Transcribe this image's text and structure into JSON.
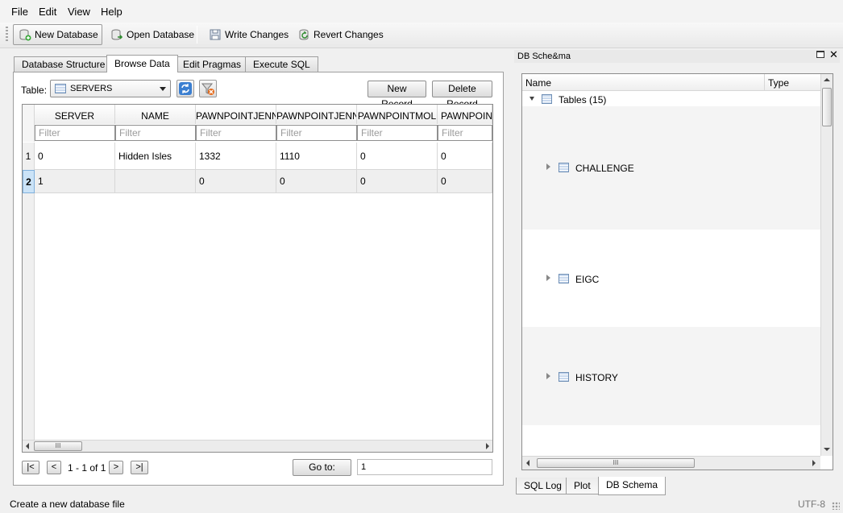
{
  "menu": [
    "File",
    "Edit",
    "View",
    "Help"
  ],
  "toolbar": {
    "new_database": "New Database",
    "open_database": "Open Database",
    "write_changes": "Write Changes",
    "revert_changes": "Revert Changes"
  },
  "tabs": [
    "Database Structure",
    "Browse Data",
    "Edit Pragmas",
    "Execute SQL"
  ],
  "browse": {
    "table_label": "Table:",
    "table_value": "SERVERS",
    "new_record": "New Record",
    "delete_record": "Delete Record",
    "columns": [
      "SERVER",
      "NAME",
      "PAWNPOINTJENN",
      "PAWNPOINTJENN",
      "PAWNPOINTMOL",
      "PAWNPOINT"
    ],
    "filter_placeholder": "Filter",
    "rows": [
      {
        "num": "1",
        "cells": [
          "0",
          "Hidden Isles",
          "1332",
          "1110",
          "0",
          "0"
        ]
      },
      {
        "num": "2",
        "cells": [
          "1",
          "",
          "0",
          "0",
          "0",
          "0"
        ]
      }
    ],
    "scroll_grip": "III"
  },
  "pager": {
    "first": "|<",
    "prev": "<",
    "range": "1 - 1 of 1",
    "next": ">",
    "last": ">|",
    "goto_label": "Go to:",
    "goto_value": "1"
  },
  "schema": {
    "title": "DB Sche&ma",
    "col_name": "Name",
    "col_type": "Type",
    "root": "Tables (15)",
    "tables": [
      "CHALLENGE",
      "EIGC",
      "HISTORY"
    ],
    "scroll_grip": "III"
  },
  "bottom_tabs": [
    "SQL Log",
    "Plot",
    "DB Schema"
  ],
  "status": {
    "message": "Create a new database file",
    "encoding": "UTF-8"
  }
}
